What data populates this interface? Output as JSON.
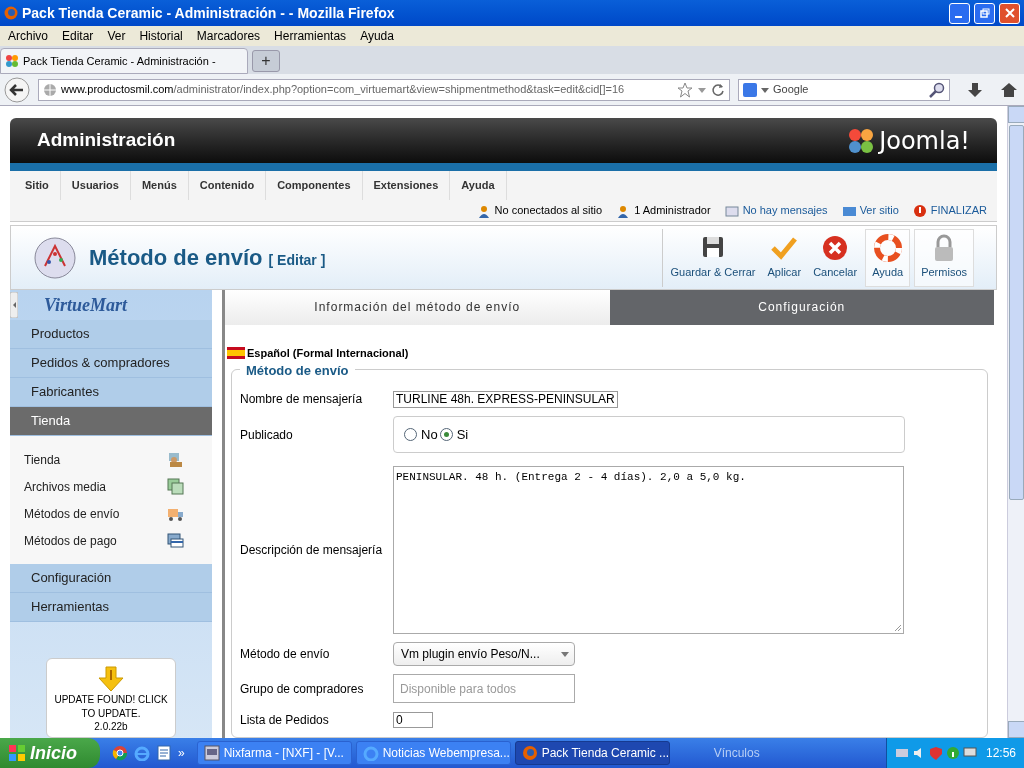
{
  "window": {
    "title": "Pack Tienda Ceramic - Administración - - Mozilla Firefox"
  },
  "browser": {
    "menu": [
      "Archivo",
      "Editar",
      "Ver",
      "Historial",
      "Marcadores",
      "Herramientas",
      "Ayuda"
    ],
    "tabs": [
      {
        "label": "Pack Tienda Ceramic - Administración -",
        "selected": true
      }
    ],
    "new_tab": "+",
    "url_host": "www.productosmil.com",
    "url_path": "/administrator/index.php?option=com_virtuemart&view=shipmentmethod&task=edit&cid[]=16",
    "search_placeholder": "Google"
  },
  "admin": {
    "title": "Administración",
    "logo": "Joomla!",
    "menu": [
      "Sitio",
      "Usuarios",
      "Menús",
      "Contenido",
      "Componentes",
      "Extensiones",
      "Ayuda"
    ],
    "status": [
      "No conectados al sitio",
      "1 Administrador",
      "No hay mensajes",
      "Ver sitio",
      "FINALIZAR"
    ]
  },
  "toolbar": {
    "title": "Método de envío",
    "subtitle": "[ Editar ]",
    "buttons": [
      "Guardar & Cerrar",
      "Aplicar",
      "Cancelar",
      "Ayuda",
      "Permisos"
    ]
  },
  "sidebar": {
    "logo": "VirtueMart",
    "sections": [
      {
        "label": "Productos",
        "expanded": false
      },
      {
        "label": "Pedidos & compradores",
        "expanded": false
      },
      {
        "label": "Fabricantes",
        "expanded": false
      },
      {
        "label": "Tienda",
        "expanded": true,
        "children": [
          "Tienda",
          "Archivos media",
          "Métodos de envío",
          "Métodos de pago"
        ]
      },
      {
        "label": "Configuración",
        "expanded": false
      },
      {
        "label": "Herramientas",
        "expanded": false
      }
    ],
    "update": {
      "message": "UPDATE FOUND! CLICK TO UPDATE.",
      "version": "2.0.22b"
    }
  },
  "form": {
    "tabs": [
      {
        "label": "Información del método de envío",
        "selected": true
      },
      {
        "label": "Configuración",
        "selected": false
      }
    ],
    "language": "Español (Formal Internacional)",
    "legend": "Método de envío",
    "fields": [
      {
        "kind": "text",
        "label": "Nombre de mensajería",
        "value": "TURLINE 48h. EXPRESS-PENINSULAR"
      },
      {
        "kind": "radio",
        "label": "Publicado",
        "options": [
          {
            "label": "No",
            "selected": false
          },
          {
            "label": "Si",
            "selected": true
          }
        ]
      },
      {
        "kind": "textarea",
        "label": "Descripción de mensajería",
        "value": "PENINSULAR. 48 h. (Entrega 2 - 4 días). 2,0 a 5,0 kg."
      },
      {
        "kind": "select",
        "label": "Método de envío",
        "value": "Vm plugin envío Peso/N..."
      },
      {
        "kind": "multiselect",
        "label": "Grupo de compradores",
        "placeholder": "Disponible para todos"
      },
      {
        "kind": "small",
        "label": "Lista de Pedidos",
        "value": "0"
      }
    ]
  },
  "taskbar": {
    "start": "Inicio",
    "more": "»",
    "windows": [
      {
        "label": "Nixfarma - [NXF] - [V...",
        "selected": false
      },
      {
        "label": "Noticias Webempresa...",
        "selected": false
      },
      {
        "label": "Pack Tienda Ceramic ...",
        "selected": true
      }
    ],
    "links": "Vínculos",
    "clock": "12:56"
  }
}
